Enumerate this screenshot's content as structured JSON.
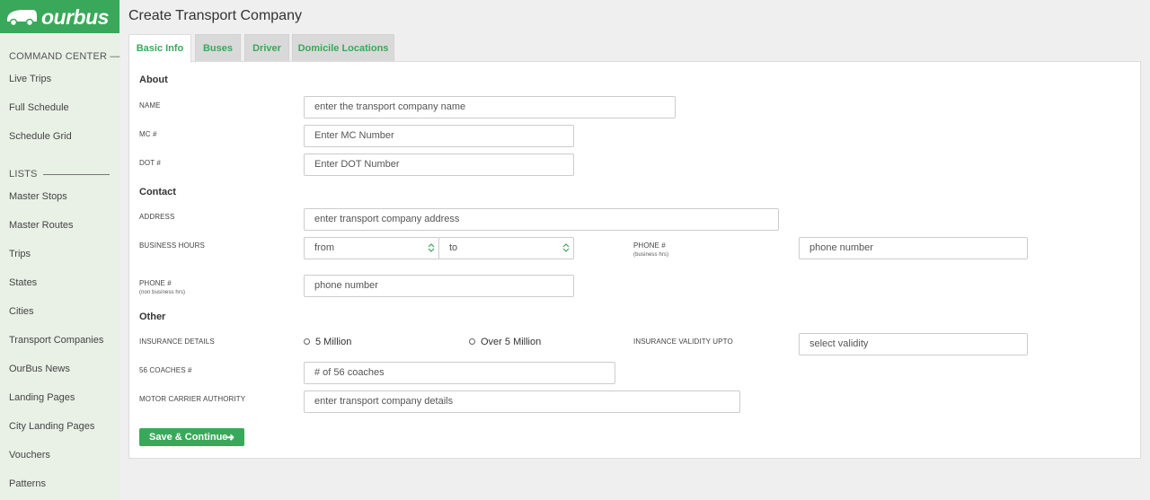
{
  "brand": {
    "name": "ourbus"
  },
  "sidebar": {
    "command_center": "COMMAND CENTER —",
    "command_items": [
      {
        "label": "Live Trips"
      },
      {
        "label": "Full Schedule"
      },
      {
        "label": "Schedule Grid"
      }
    ],
    "lists_head": "LISTS",
    "list_items": [
      {
        "label": "Master Stops"
      },
      {
        "label": "Master Routes"
      },
      {
        "label": "Trips"
      },
      {
        "label": "States"
      },
      {
        "label": "Cities"
      },
      {
        "label": "Transport Companies"
      },
      {
        "label": "OurBus News"
      },
      {
        "label": "Landing Pages"
      },
      {
        "label": "City Landing Pages"
      },
      {
        "label": "Vouchers"
      },
      {
        "label": "Patterns"
      }
    ]
  },
  "page": {
    "title": "Create Transport Company"
  },
  "tabs": [
    {
      "label": "Basic Info"
    },
    {
      "label": "Buses"
    },
    {
      "label": "Driver"
    },
    {
      "label": "Domicile Locations"
    }
  ],
  "form": {
    "about_head": "About",
    "name_label": "NAME",
    "name_placeholder": "enter the transport company name",
    "mc_label": "MC #",
    "mc_placeholder": "Enter MC Number",
    "dot_label": "DOT #",
    "dot_placeholder": "Enter DOT Number",
    "contact_head": "Contact",
    "address_label": "ADDRESS",
    "address_placeholder": "enter transport company address",
    "hours_label": "BUSINESS HOURS",
    "hours_from": "from",
    "hours_to": "to",
    "phone_business_label": "PHONE #",
    "phone_business_sub": "(business hrs)",
    "phone_business_placeholder": "phone number",
    "phone_nonbusiness_label": "PHONE #",
    "phone_nonbusiness_sub": "(non business hrs)",
    "phone_nonbusiness_placeholder": "phone number",
    "other_head": "Other",
    "insurance_label": "INSURANCE DETAILS",
    "insurance_option_1": "5 Million",
    "insurance_option_2": "Over 5 Million",
    "validity_label": "INSURANCE VALIDITY UPTO",
    "validity_placeholder": "select validity",
    "coaches_label": "56 COACHES #",
    "coaches_placeholder": "# of 56 coaches",
    "authority_label": "MOTOR CARRIER AUTHORITY",
    "authority_placeholder": "enter transport company details",
    "save_label": "Save & Continue"
  },
  "colors": {
    "brand_green": "#3aa85a",
    "sidebar_bg": "#e9f1e6",
    "page_bg": "#efefef"
  }
}
